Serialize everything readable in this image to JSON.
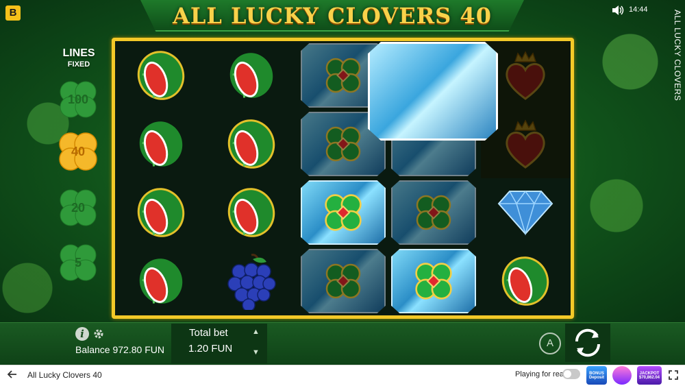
{
  "header": {
    "brand_logo": "B",
    "game_title": "ALL LUCKY CLOVERS 40",
    "clock": "14:44",
    "side_title": "ALL LUCKY CLOVERS",
    "icons": [
      "sound-icon"
    ]
  },
  "lines_panel": {
    "label": "LINES",
    "sublabel": "FIXED",
    "options": [
      "100",
      "40",
      "20",
      "5"
    ],
    "selected": "40"
  },
  "reels": [
    [
      "watermelon",
      "watermelon",
      "watermelon",
      "watermelon"
    ],
    [
      "watermelon",
      "watermelon",
      "watermelon",
      "grapes"
    ],
    [
      "clover-gem",
      "clover-gem",
      "clover-gem-bright",
      "clover-gem"
    ],
    [
      "clover-gem-big",
      "clover-gem",
      "clover-gem",
      "clover-gem-bright"
    ],
    [
      "heart-crown",
      "heart-crown",
      "diamond",
      "watermelon"
    ]
  ],
  "controls": {
    "balance_label": "Balance 972.80 FUN",
    "total_bet_label": "Total bet",
    "total_bet_value": "1.20 FUN",
    "autoplay_label": "A"
  },
  "footer": {
    "game_name": "All Lucky Clovers 40",
    "play_real_label": "Playing for real",
    "promo_bonus": [
      "BONUS",
      "Deposit"
    ],
    "promo_jackpot_amount": "$70,862.04",
    "promo_jackpot_label": "JACKPOT"
  },
  "colors": {
    "frame_gold": "#f3c928",
    "background_green": "#10511a",
    "title_gold": "#f8d24a"
  }
}
